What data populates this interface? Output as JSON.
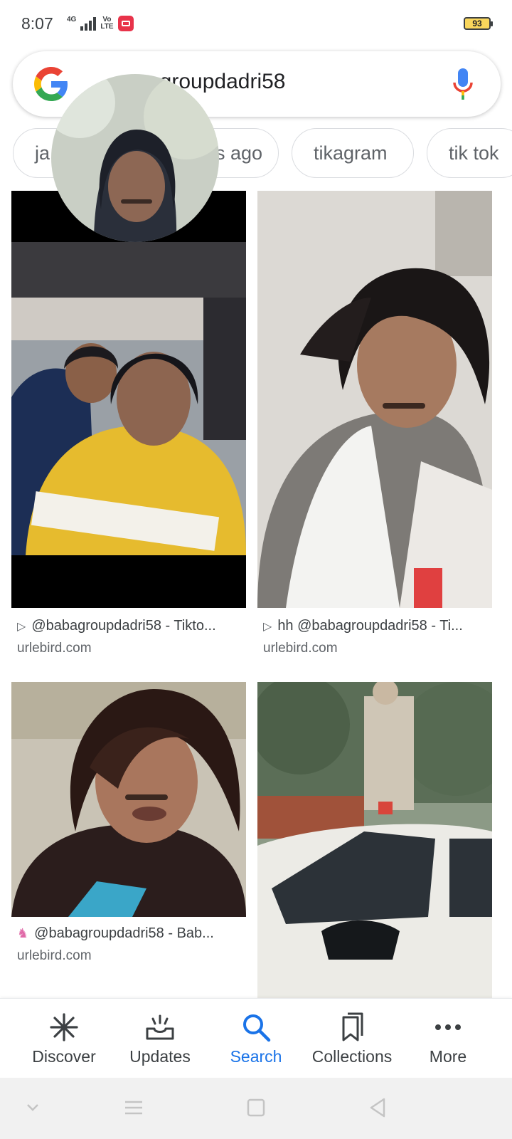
{
  "status_bar": {
    "time": "8:07",
    "network": "4G",
    "volte_top": "Vo",
    "volte_bottom": "LTE",
    "battery": "93"
  },
  "search": {
    "query": "babagroupdadri58",
    "visible_query_text": "agroupdadri58",
    "logo_icon": "google-g-icon",
    "mic_icon": "microphone-icon"
  },
  "chips": [
    {
      "label": "ja"
    },
    {
      "label": "s ago"
    },
    {
      "label": "tikagram"
    },
    {
      "label": "tik tok"
    }
  ],
  "results": [
    {
      "caption": "@babagroupdadri58 - Tikto...",
      "domain": "urlebird.com",
      "icon": "play-icon"
    },
    {
      "caption": "hh @babagroupdadri58 - Ti...",
      "domain": "urlebird.com",
      "icon": "play-icon"
    },
    {
      "caption": "@babagroupdadri58 - Bab...",
      "domain": "urlebird.com",
      "icon": "unicorn-icon"
    },
    {
      "caption": "",
      "domain": "",
      "icon": ""
    }
  ],
  "bottom_nav": [
    {
      "label": "Discover",
      "icon": "asterisk-icon",
      "active": false
    },
    {
      "label": "Updates",
      "icon": "inbox-tray-icon",
      "active": false
    },
    {
      "label": "Search",
      "icon": "search-icon",
      "active": true
    },
    {
      "label": "Collections",
      "icon": "bookmarks-icon",
      "active": false
    },
    {
      "label": "More",
      "icon": "more-dots-icon",
      "active": false
    }
  ],
  "colors": {
    "active": "#1a73e8",
    "text": "#3c4043",
    "google_blue": "#4285F4",
    "google_red": "#EA4335",
    "google_yellow": "#FBBC05",
    "google_green": "#34A853"
  }
}
